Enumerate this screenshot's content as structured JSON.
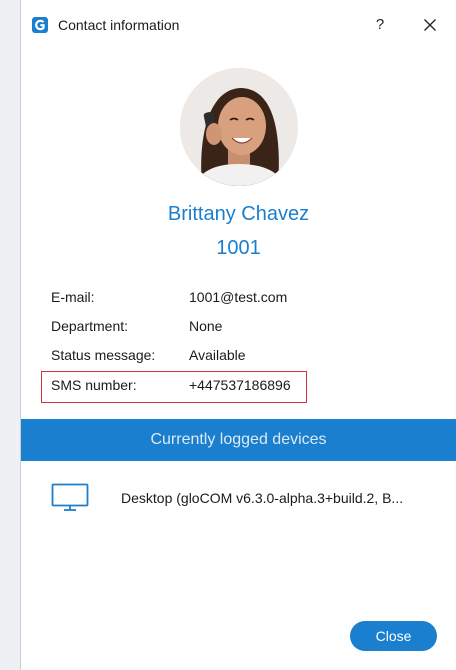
{
  "window": {
    "title": "Contact information",
    "help_label": "?",
    "close_icon": "close-icon"
  },
  "contact": {
    "name": "Brittany Chavez",
    "extension": "1001"
  },
  "info": {
    "email_label": "E-mail:",
    "email_value": "1001@test.com",
    "department_label": "Department:",
    "department_value": "None",
    "status_label": "Status message:",
    "status_value": "Available",
    "sms_label": "SMS number:",
    "sms_value": "+447537186896"
  },
  "devices": {
    "header": "Currently logged devices",
    "items": [
      {
        "icon": "monitor-icon",
        "label": "Desktop (gloCOM v6.3.0-alpha.3+build.2, B..."
      }
    ]
  },
  "footer": {
    "close_label": "Close"
  },
  "colors": {
    "accent": "#1a7fce",
    "highlight": "#d9303a"
  }
}
